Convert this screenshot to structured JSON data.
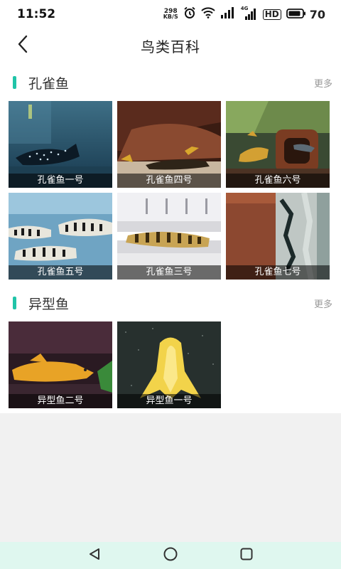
{
  "status": {
    "time": "11:52",
    "net_speed_value": "298",
    "net_speed_unit": "KB/S",
    "battery": "70",
    "signal1_label": "4G",
    "hd_label": "HD"
  },
  "header": {
    "title": "鸟类百科"
  },
  "sections": [
    {
      "title": "孔雀鱼",
      "more": "更多",
      "items": [
        {
          "label": "孔雀鱼一号"
        },
        {
          "label": "孔雀鱼四号"
        },
        {
          "label": "孔雀鱼六号"
        },
        {
          "label": "孔雀鱼五号"
        },
        {
          "label": "孔雀鱼三号"
        },
        {
          "label": "孔雀鱼七号"
        }
      ]
    },
    {
      "title": "异型鱼",
      "more": "更多",
      "items": [
        {
          "label": "异型鱼二号"
        },
        {
          "label": "异型鱼一号"
        }
      ]
    }
  ],
  "colors": {
    "accent": "#20c4a8",
    "nav_bg": "#dff7ef"
  },
  "icons": {
    "back": "chevron-left-icon",
    "nav_back": "triangle-back-icon",
    "nav_home": "circle-home-icon",
    "nav_recent": "square-recent-icon"
  }
}
